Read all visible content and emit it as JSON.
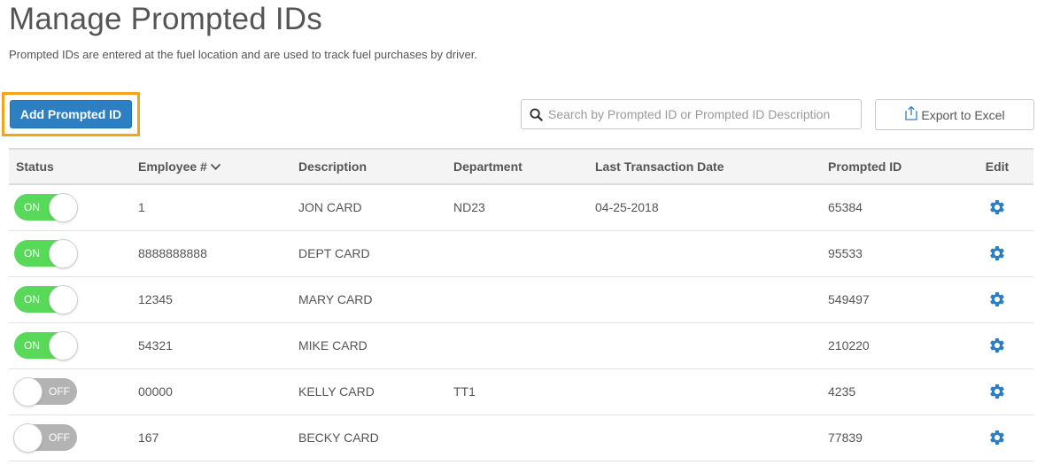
{
  "page": {
    "title": "Manage Prompted IDs",
    "subtitle": "Prompted IDs are entered at the fuel location and are used to track fuel purchases by driver."
  },
  "toolbar": {
    "add_label": "Add Prompted ID",
    "search_placeholder": "Search by Prompted ID or Prompted ID Description",
    "search_value": "",
    "export_label": "Export to Excel"
  },
  "table": {
    "columns": {
      "status": "Status",
      "employee": "Employee #",
      "description": "Description",
      "department": "Department",
      "last_transaction": "Last Transaction Date",
      "prompted_id": "Prompted ID",
      "edit": "Edit"
    },
    "sort_column": "employee",
    "rows": [
      {
        "status": "ON",
        "employee": "1",
        "description": "JON CARD",
        "department": "ND23",
        "last_transaction": "04-25-2018",
        "prompted_id": "65384"
      },
      {
        "status": "ON",
        "employee": "8888888888",
        "description": "DEPT CARD",
        "department": "",
        "last_transaction": "",
        "prompted_id": "95533"
      },
      {
        "status": "ON",
        "employee": "12345",
        "description": "MARY CARD",
        "department": "",
        "last_transaction": "",
        "prompted_id": "549497"
      },
      {
        "status": "ON",
        "employee": "54321",
        "description": "MIKE CARD",
        "department": "",
        "last_transaction": "",
        "prompted_id": "210220"
      },
      {
        "status": "OFF",
        "employee": "00000",
        "description": "KELLY CARD",
        "department": "TT1",
        "last_transaction": "",
        "prompted_id": "4235"
      },
      {
        "status": "OFF",
        "employee": "167",
        "description": "BECKY CARD",
        "department": "",
        "last_transaction": "",
        "prompted_id": "77839"
      }
    ]
  },
  "icons": {
    "search": "search-icon",
    "export": "export-icon",
    "sort": "chevron-down-icon",
    "edit": "gear-icon"
  },
  "colors": {
    "primary": "#2d7fc4",
    "highlight": "#f5a21c",
    "toggle_on": "#58d95a",
    "toggle_off": "#b3b3b3",
    "gear": "#2d7fc4"
  }
}
